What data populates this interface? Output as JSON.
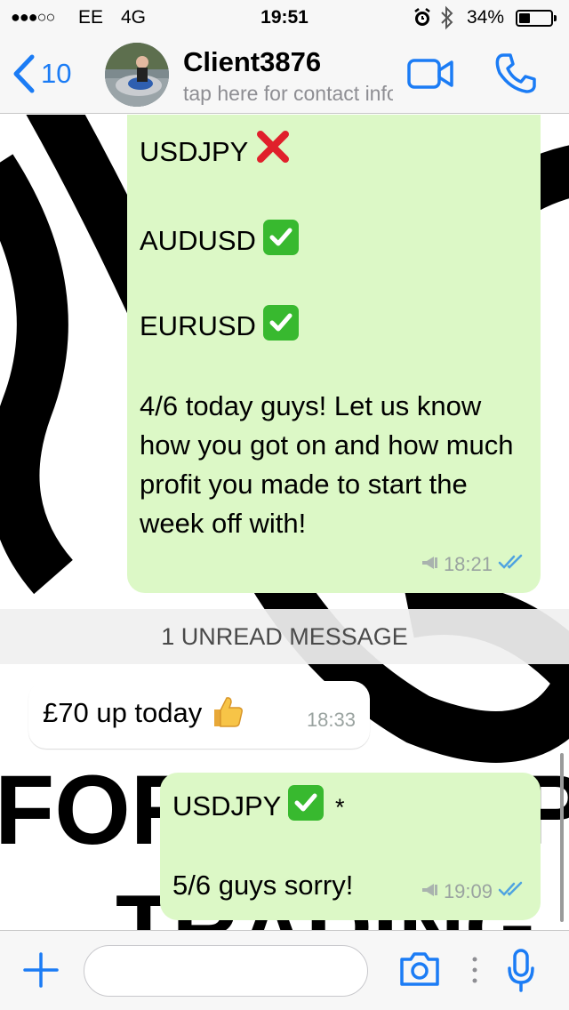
{
  "status_bar": {
    "signal": "●●●○○",
    "carrier": "EE",
    "network": "4G",
    "time": "19:51",
    "battery_percent": "34%",
    "battery_level": 0.34
  },
  "header": {
    "back_count": "10",
    "contact_name": "Client3876",
    "contact_subtitle": "tap here for contact info"
  },
  "messages": {
    "m1": {
      "line1": "USDJPY",
      "line2": "AUDUSD",
      "line3": "EURUSD",
      "text": "4/6 today guys! Let us know how you got on and how much profit you made to start the week off with!",
      "time": "18:21"
    },
    "unread_label": "1 UNREAD MESSAGE",
    "m2": {
      "text": "£70 up today",
      "time": "18:33"
    },
    "m3": {
      "line1": "USDJPY",
      "line1_suffix": "*",
      "line2": "5/6 guys sorry!",
      "time": "19:09"
    }
  },
  "wallpaper": {
    "word1": "FOREX",
    "word2": "TRADING"
  },
  "input": {
    "placeholder": ""
  },
  "colors": {
    "accent": "#1b7cf5",
    "outgoing_bubble": "#dcf8c6",
    "incoming_bubble": "#ffffff",
    "check_emoji": "#38b92f",
    "cross_emoji": "#e0202b",
    "read_ticks": "#4fa3e0"
  },
  "icons": [
    "back-chevron-icon",
    "video-call-icon",
    "phone-icon",
    "cross-mark-icon",
    "check-mark-icon",
    "broadcast-icon",
    "double-tick-icon",
    "thumbs-up-icon",
    "plus-icon",
    "camera-icon",
    "microphone-icon"
  ]
}
